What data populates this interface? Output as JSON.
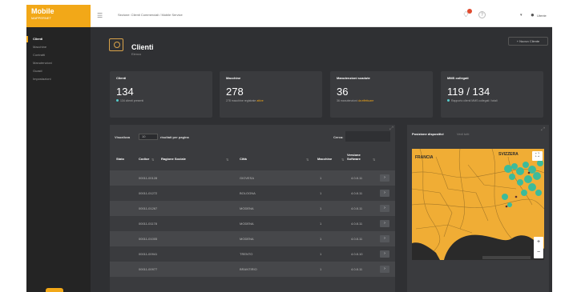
{
  "sidebar": {
    "logo_title": "Mobile",
    "logo_sub": "MAPPERNET",
    "items": [
      {
        "label": "Clienti",
        "active": true
      },
      {
        "label": "Macchine",
        "active": false
      },
      {
        "label": "Contratti",
        "active": false
      },
      {
        "label": "Manutenzioni",
        "active": false
      },
      {
        "label": "Guasti",
        "active": false
      },
      {
        "label": "Impostazioni",
        "active": false
      }
    ]
  },
  "topbar": {
    "title": "Sezione: Clienti Commerciali / Mobile Service",
    "user": "Utente"
  },
  "header": {
    "title": "Clienti",
    "subtitle": "Elenco",
    "new_button": "+ Nuovo Cliente"
  },
  "cards": [
    {
      "label": "Clienti",
      "value": "134",
      "desc": "134 clienti presenti",
      "highlight": ""
    },
    {
      "label": "Macchine",
      "value": "278",
      "desc": "278 macchine registrate",
      "highlight": "attive"
    },
    {
      "label": "Manutenzioni scadute",
      "value": "36",
      "desc": "36 manutenzioni",
      "highlight": "da effettuare"
    },
    {
      "label": "MMS collegati",
      "value": "119 / 134",
      "desc": "Rapporto clienti MMS collegati / totali",
      "highlight": ""
    }
  ],
  "table": {
    "show_label": "Visualizza",
    "show_value": "10",
    "show_after": "risultati per pagina",
    "search_label": "Cerca:",
    "headers": [
      "Stato",
      "Codice",
      "Ragione Sociale",
      "Città",
      "Macchine",
      "Versione Software",
      ""
    ],
    "rows": [
      {
        "code": "00011-00128",
        "city": "GIOVESA",
        "machines": "1",
        "version": "4.0.8.11",
        "btn": "›"
      },
      {
        "code": "00011-01272",
        "city": "BOLOGNA",
        "machines": "1",
        "version": "4.0.8.11",
        "btn": "›"
      },
      {
        "code": "00011-01267",
        "city": "MODENA",
        "machines": "1",
        "version": "4.0.8.11",
        "btn": "›"
      },
      {
        "code": "00011-01178",
        "city": "MODENA",
        "machines": "1",
        "version": "4.0.8.11",
        "btn": "›"
      },
      {
        "code": "00011-01005",
        "city": "MODENA",
        "machines": "1",
        "version": "4.0.8.11",
        "btn": "›"
      },
      {
        "code": "00011-00941",
        "city": "TRENTO",
        "machines": "1",
        "version": "4.0.8.10",
        "btn": "›"
      },
      {
        "code": "00011-00977",
        "city": "BRANTIRIO",
        "machines": "1",
        "version": "4.0.8.11",
        "btn": "›"
      }
    ]
  },
  "map": {
    "title": "Posizione dispositivi",
    "link": "Vedi tutti",
    "labels": [
      "FRANCIA",
      "SVIZZERA"
    ],
    "zoom_in": "+",
    "zoom_out": "−",
    "land_color": "#f0ad35",
    "sea_color": "#2a2a2a",
    "marker_color": "#3dbb9a"
  }
}
